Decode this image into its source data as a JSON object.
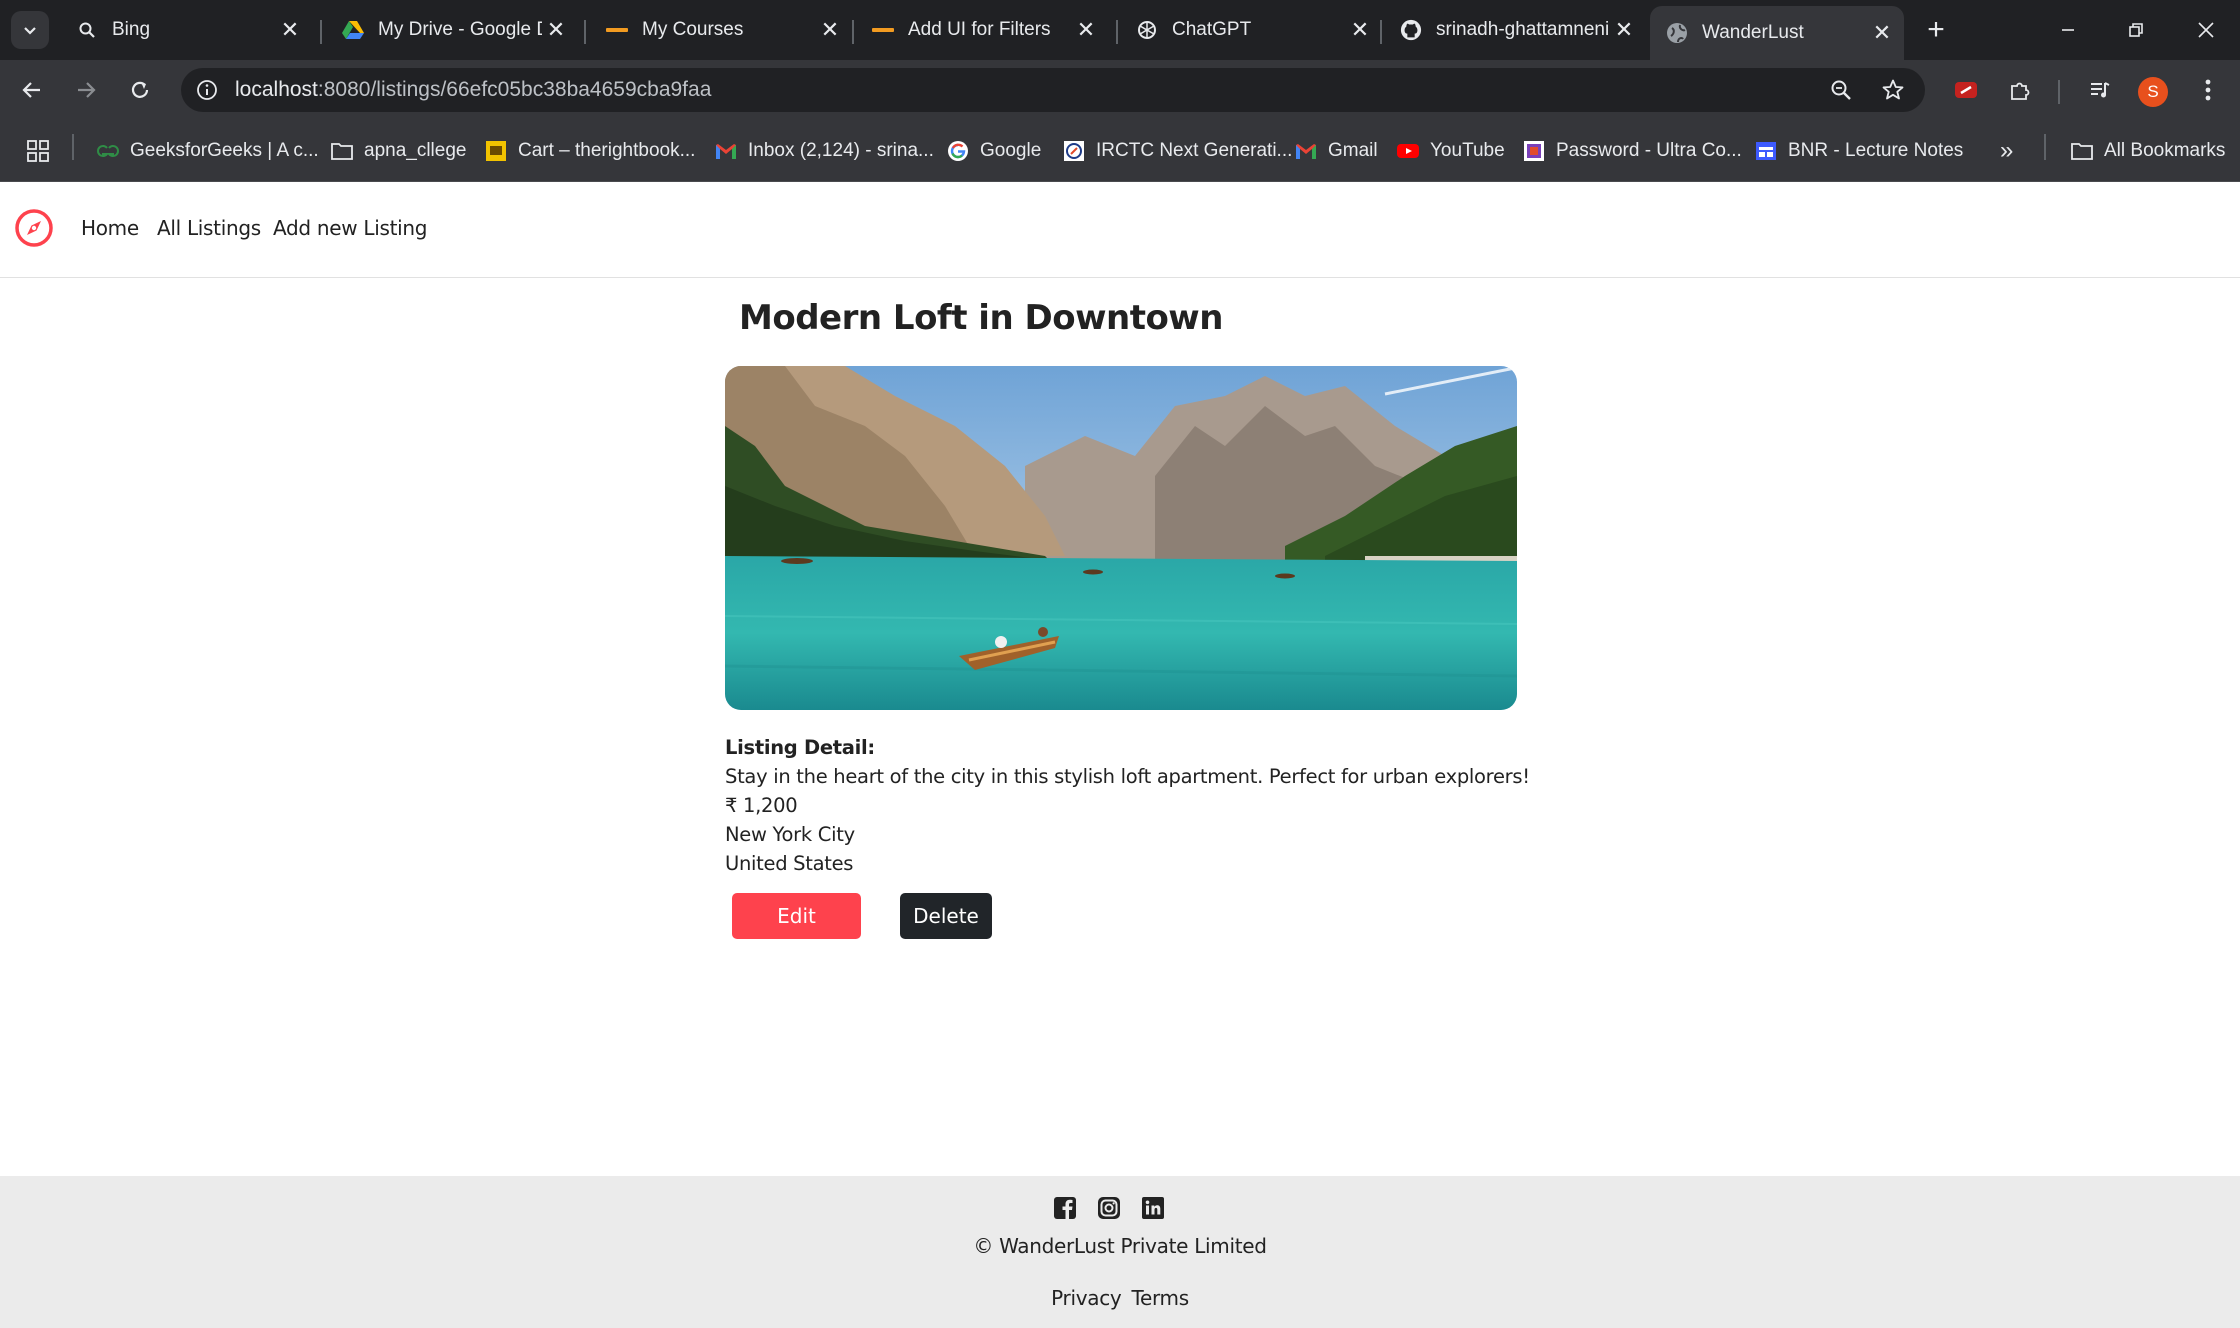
{
  "browser": {
    "tabs": [
      {
        "title": "Bing",
        "icon": "search-icon"
      },
      {
        "title": "My Drive - Google Drive",
        "icon": "google-drive-icon"
      },
      {
        "title": "My Courses",
        "icon": "course-logo-icon"
      },
      {
        "title": "Add UI for Filters",
        "icon": "course-logo-icon"
      },
      {
        "title": "ChatGPT",
        "icon": "openai-icon"
      },
      {
        "title": "srinadh-ghattamneni",
        "icon": "github-icon"
      },
      {
        "title": "WanderLust",
        "icon": "globe-icon"
      }
    ],
    "url_host": "localhost",
    "url_path": ":8080/listings/66efc05bc38ba4659cba9faa",
    "profile_initial": "S",
    "bookmarks": [
      {
        "label": "GeeksforGeeks | A c...",
        "icon": "gfg-icon"
      },
      {
        "label": "apna_cllege",
        "icon": "folder-icon"
      },
      {
        "label": "Cart – therightbook...",
        "icon": "bookstore-icon"
      },
      {
        "label": "Inbox (2,124) - srina...",
        "icon": "gmail-icon"
      },
      {
        "label": "Google",
        "icon": "google-icon"
      },
      {
        "label": "IRCTC Next Generati...",
        "icon": "irctc-icon"
      },
      {
        "label": "Gmail",
        "icon": "gmail-icon"
      },
      {
        "label": "YouTube",
        "icon": "youtube-icon"
      },
      {
        "label": "Password - Ultra Co...",
        "icon": "ultra-icon"
      },
      {
        "label": "BNR - Lecture Notes",
        "icon": "notes-icon"
      }
    ],
    "all_bookmarks_label": "All Bookmarks",
    "overflow_label": "»"
  },
  "site": {
    "nav": {
      "home": "Home",
      "all_listings": "All Listings",
      "add_new": "Add new Listing"
    },
    "brand_color": "#fe424d"
  },
  "listing": {
    "title": "Modern Loft in Downtown",
    "detail_label": "Listing Detail:",
    "description": "Stay in the heart of the city in this stylish loft apartment. Perfect for urban explorers!",
    "price": "₹ 1,200",
    "location": "New York City",
    "country": "United States",
    "edit_label": "Edit",
    "delete_label": "Delete"
  },
  "footer": {
    "copyright": "© WanderLust Private Limited",
    "privacy": "Privacy",
    "terms": "Terms"
  }
}
